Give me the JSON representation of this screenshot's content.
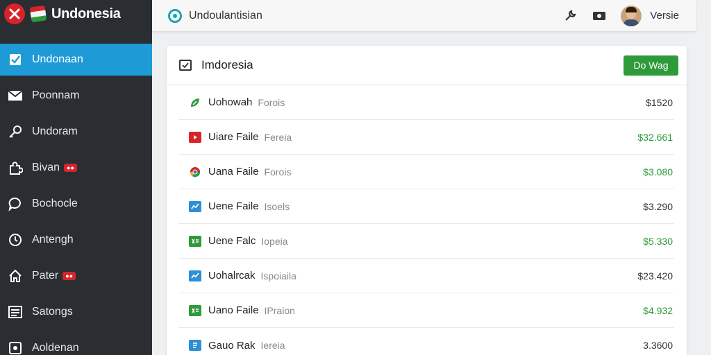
{
  "brand": {
    "name": "Undonesia"
  },
  "colors": {
    "accent": "#1e9bd7",
    "positive": "#2e9a3a",
    "danger": "#d8232a",
    "sidebar": "#2a2d31"
  },
  "sidebar": {
    "items": [
      {
        "label": "Undonaan",
        "icon": "checkbox-icon",
        "active": true
      },
      {
        "label": "Poonnam",
        "icon": "mail-icon"
      },
      {
        "label": "Undoram",
        "icon": "key-icon"
      },
      {
        "label": "Bivan",
        "icon": "puzzle-icon",
        "badge": "●●"
      },
      {
        "label": "Bochocle",
        "icon": "chat-icon"
      },
      {
        "label": "Antengh",
        "icon": "clock-icon"
      },
      {
        "label": "Pater",
        "icon": "home-icon",
        "badge": "●●"
      },
      {
        "label": "Satongs",
        "icon": "list-icon"
      },
      {
        "label": "Aoldenan",
        "icon": "image-icon"
      }
    ]
  },
  "header": {
    "title": "Undoulantisian",
    "user_name": "Versie"
  },
  "main": {
    "title": "Imdoresia",
    "action_label": "Do Wag",
    "rows": [
      {
        "name": "Uohowah",
        "type": "Forois",
        "amount": "$1520",
        "icon": "leaf-icon",
        "positive": false
      },
      {
        "name": "Uiare Faile",
        "type": "Fereia",
        "amount": "$32.661",
        "icon": "youtube-icon",
        "positive": true
      },
      {
        "name": "Uana Faile",
        "type": "Forois",
        "amount": "$3.080",
        "icon": "chrome-icon",
        "positive": true
      },
      {
        "name": "Uene Faile",
        "type": "Isoels",
        "amount": "$3.290",
        "icon": "chart-icon",
        "positive": false
      },
      {
        "name": "Uene Falc",
        "type": "Iopeia",
        "amount": "$5.330",
        "icon": "spreadsheet-icon",
        "positive": true
      },
      {
        "name": "Uohalrcak",
        "type": "Ispoiaila",
        "amount": "$23.420",
        "icon": "chart-icon",
        "positive": false
      },
      {
        "name": "Uano Faile",
        "type": "IPraion",
        "amount": "$4.932",
        "icon": "spreadsheet-icon",
        "positive": true
      },
      {
        "name": "Gauo Rak",
        "type": "Iereia",
        "amount": "3.3600",
        "icon": "document-icon",
        "positive": false
      }
    ]
  }
}
